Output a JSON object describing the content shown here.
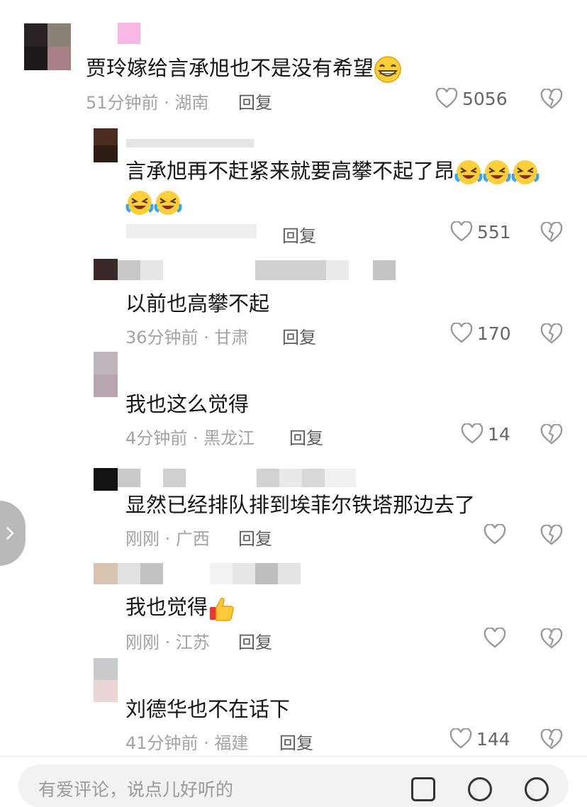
{
  "comments": [
    {
      "text": "贾玲嫁给言承旭也不是没有希望",
      "time": "51分钟前 · 湖南",
      "reply_label": "回复",
      "likes": "5056"
    },
    {
      "text_line1": "言承旭再不赶紧来就要高攀不起了昂",
      "text_line2": "",
      "reply_label": "回复",
      "likes": "551"
    },
    {
      "text": "以前也高攀不起",
      "time": "36分钟前 · 甘肃",
      "reply_label": "回复",
      "likes": "170"
    },
    {
      "text": "我也这么觉得",
      "time": "4分钟前 · 黑龙江",
      "reply_label": "回复",
      "likes": "14"
    },
    {
      "text": "显然已经排队排到埃菲尔铁塔那边去了",
      "time": "刚刚 · 广西",
      "reply_label": "回复",
      "likes": ""
    },
    {
      "text": "我也觉得",
      "time": "刚刚 · 江苏",
      "reply_label": "回复",
      "likes": ""
    },
    {
      "text": "刘德华也不在话下",
      "time": "41分钟前 · 福建",
      "reply_label": "回复",
      "likes": "144"
    }
  ],
  "input": {
    "placeholder": "有爱评论，说点儿好听的"
  },
  "icons": {
    "like": "heart-outline-icon",
    "dislike": "broken-heart-icon",
    "side": "chevron-right-icon",
    "emoji_grin": "grinning-face-icon",
    "emoji_laugh": "rolling-laughing-face-icon",
    "emoji_thumb": "thumbs-up-icon"
  },
  "colors": {
    "text": "#161616",
    "meta": "#a3a3a3",
    "reply": "#5c5c5c",
    "icon": "#999999"
  }
}
